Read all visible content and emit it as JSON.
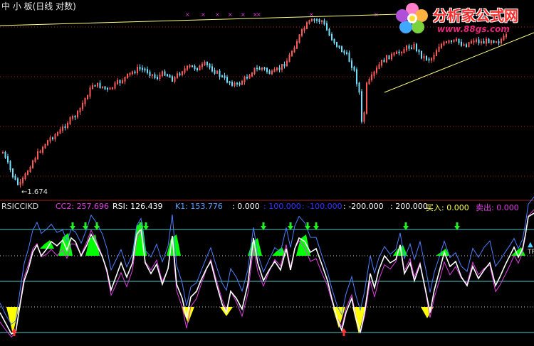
{
  "title": "中 小 板(日线 对数)",
  "low_label": "1.674",
  "indicator": {
    "name": "RSICCIKD",
    "values": [
      {
        "label": "CC2:",
        "value": "257.696",
        "color": "#e040e0"
      },
      {
        "label": "RSI:",
        "value": "126.439",
        "color": "#ffffff"
      },
      {
        "label": "K1:",
        "value": "153.776",
        "color": "#5aa0ff"
      },
      {
        "label": ":",
        "value": "0.000",
        "color": "#ffffff"
      },
      {
        "label": ":",
        "value": "100.000",
        "color": "#3333ff"
      },
      {
        "label": ":",
        "value": "-100.000",
        "color": "#3333ff"
      },
      {
        "label": ":",
        "value": "-200.000",
        "color": "#ffffff"
      },
      {
        "label": ":",
        "value": "200.000",
        "color": "#ffffff"
      },
      {
        "label": "买入:",
        "value": "0.000",
        "color": "#ffff55"
      },
      {
        "label": "卖出:",
        "value": "0.000",
        "color": "#e040e0"
      }
    ]
  },
  "logo": {
    "name": "分析家公式网",
    "url": "www.88gs.com"
  },
  "right_tag": "TR",
  "colors": {
    "up": "#ff5a5a",
    "down": "#6fe0ff",
    "trend": "#ffff80",
    "rsi": "#ffffff",
    "k1": "#4f7fff",
    "cc2": "#e040e0",
    "sell_fill": "#00ff00",
    "buy_fill": "#ffff00",
    "level": "#50c8c8"
  }
}
